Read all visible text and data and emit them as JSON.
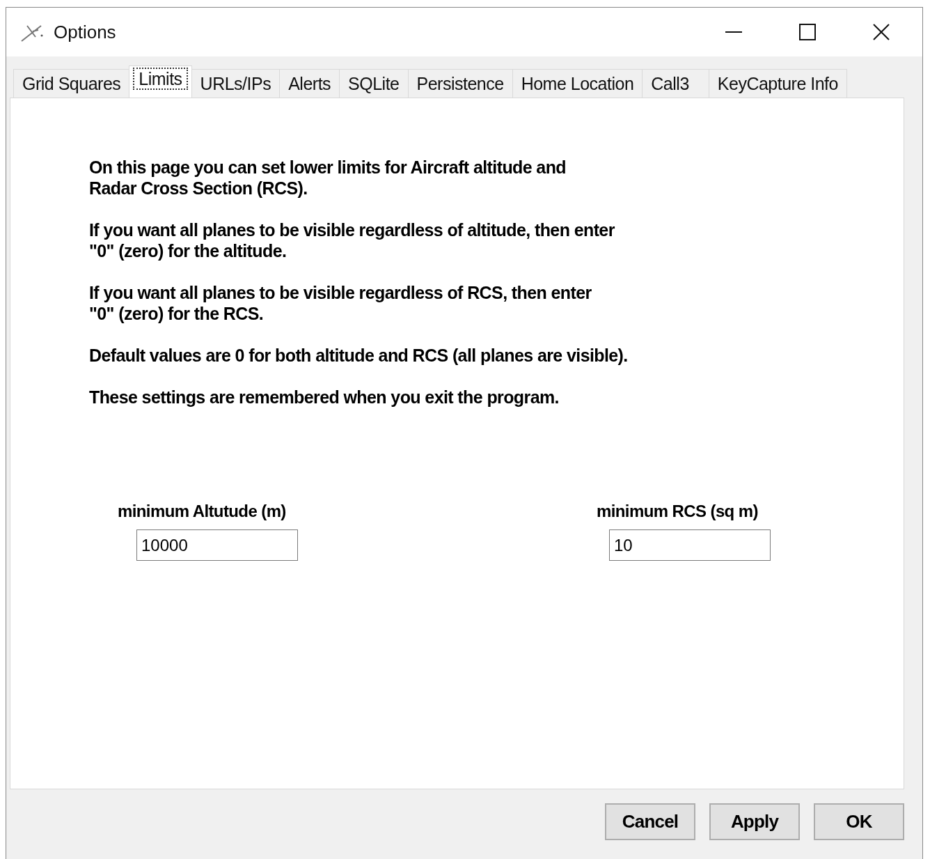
{
  "window": {
    "title": "Options"
  },
  "tabs": [
    {
      "label": "Grid Squares",
      "selected": false
    },
    {
      "label": "Limits",
      "selected": true
    },
    {
      "label": "URLs/IPs",
      "selected": false
    },
    {
      "label": "Alerts",
      "selected": false
    },
    {
      "label": "SQLite",
      "selected": false
    },
    {
      "label": "Persistence",
      "selected": false
    },
    {
      "label": "Home Location",
      "selected": false
    },
    {
      "label": "Call3",
      "selected": false
    },
    {
      "label": "KeyCapture Info",
      "selected": false
    }
  ],
  "paragraphs": [
    "On this page you can set lower limits for Aircraft altitude and\nRadar Cross Section (RCS).",
    "If you want all planes to be visible regardless of altitude, then enter\n\"0\" (zero) for the altitude.",
    "If you want all planes to be visible regardless of RCS, then enter\n\"0\" (zero) for the RCS.",
    "Default values are 0 for both altitude and RCS (all planes are visible).",
    "These settings are remembered when you exit the program."
  ],
  "fields": [
    {
      "label": "minimum Altutude (m)",
      "value": "10000"
    },
    {
      "label": "minimum RCS (sq m)",
      "value": "10"
    }
  ],
  "buttons": [
    "Cancel",
    "Apply",
    "OK"
  ]
}
